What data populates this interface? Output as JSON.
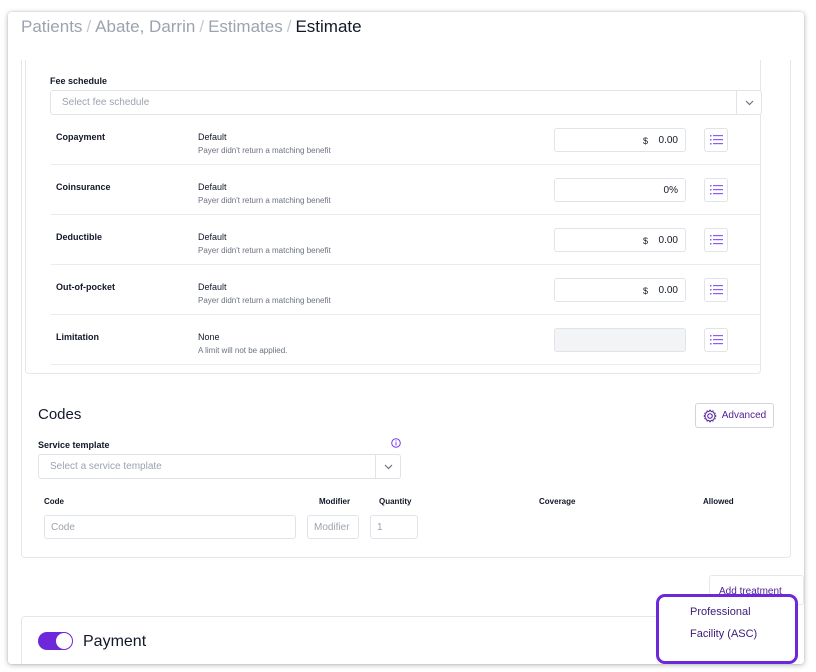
{
  "breadcrumb": {
    "items": [
      "Patients",
      "Abate, Darrin",
      "Estimates"
    ],
    "separator": "/",
    "current": "Estimate"
  },
  "fee_schedule": {
    "label": "Fee schedule",
    "placeholder": "Select fee schedule"
  },
  "benefits": [
    {
      "name": "Copayment",
      "source": "Default",
      "note": "Payer didn't return a matching benefit",
      "currency": "$",
      "value": "0.00",
      "disabled": false
    },
    {
      "name": "Coinsurance",
      "source": "Default",
      "note": "Payer didn't return a matching benefit",
      "currency": "",
      "value": "0%",
      "disabled": false
    },
    {
      "name": "Deductible",
      "source": "Default",
      "note": "Payer didn't return a matching benefit",
      "currency": "$",
      "value": "0.00",
      "disabled": false
    },
    {
      "name": "Out-of-pocket",
      "source": "Default",
      "note": "Payer didn't return a matching benefit",
      "currency": "$",
      "value": "0.00",
      "disabled": false
    },
    {
      "name": "Limitation",
      "source": "None",
      "note": "A limit will not be applied.",
      "currency": "",
      "value": "",
      "disabled": true
    }
  ],
  "codes": {
    "title": "Codes",
    "advanced_label": "Advanced",
    "service_template_label": "Service template",
    "service_template_placeholder": "Select a service template",
    "columns": {
      "code": "Code",
      "modifier": "Modifier",
      "quantity": "Quantity",
      "coverage": "Coverage",
      "allowed": "Allowed"
    },
    "row": {
      "code_placeholder": "Code",
      "modifier_placeholder": "Modifier",
      "quantity_placeholder": "1"
    }
  },
  "add_treatment_label": "Add treatment",
  "dropdown": {
    "items": [
      "Professional",
      "Facility (ASC)"
    ]
  },
  "payment": {
    "label": "Payment",
    "enabled": true
  },
  "colors": {
    "accent": "#6d28d9",
    "accent_text": "#4c1d95",
    "border": "#e5e7eb",
    "muted": "#9ca3af"
  },
  "icons": {
    "list": "list-icon",
    "chevron": "chevron-down-icon",
    "gear": "gear-icon",
    "info": "info-icon"
  }
}
